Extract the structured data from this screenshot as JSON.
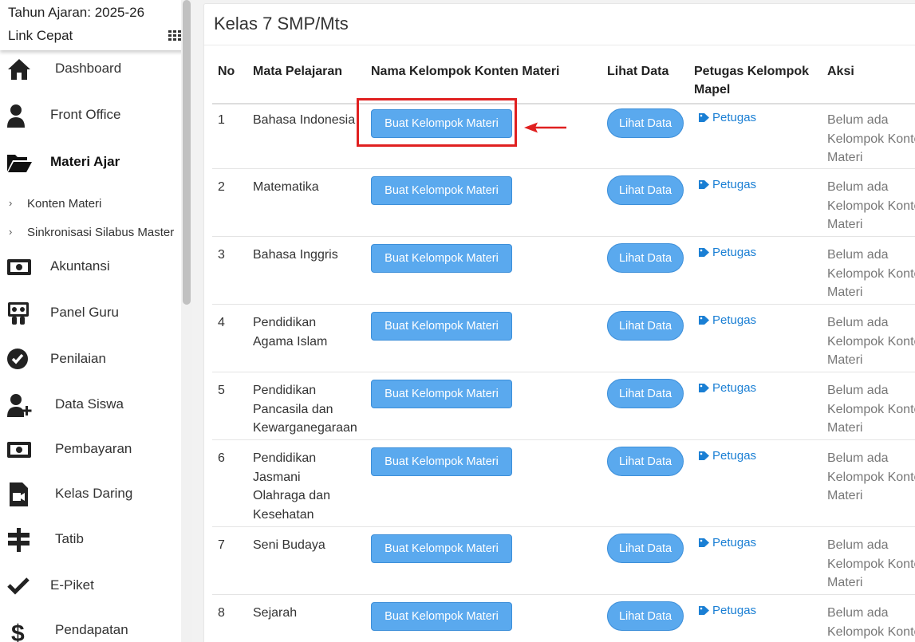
{
  "sidebar": {
    "academic_year": "Tahun Ajaran: 2025-26",
    "quick_link": "Link Cepat",
    "items": [
      {
        "label": "Dashboard",
        "icon": "home-icon"
      },
      {
        "label": "Front Office",
        "icon": "user-icon"
      },
      {
        "label": "Materi Ajar",
        "icon": "folder-open-icon",
        "active": true
      },
      {
        "label": "Akuntansi",
        "icon": "money-icon"
      },
      {
        "label": "Panel Guru",
        "icon": "presentation-icon"
      },
      {
        "label": "Penilaian",
        "icon": "check-circle-icon"
      },
      {
        "label": "Data Siswa",
        "icon": "user-plus-icon"
      },
      {
        "label": "Pembayaran",
        "icon": "money-icon"
      },
      {
        "label": "Kelas Daring",
        "icon": "video-file-icon"
      },
      {
        "label": "Tatib",
        "icon": "signpost-icon"
      },
      {
        "label": "E-Piket",
        "icon": "checkmark-icon"
      },
      {
        "label": "Pendapatan",
        "icon": "dollar-icon"
      }
    ],
    "submenu": [
      {
        "label": "Konten Materi"
      },
      {
        "label": "Sinkronisasi Silabus Master"
      }
    ]
  },
  "main": {
    "title": "Kelas 7 SMP/Mts",
    "columns": [
      "No",
      "Mata Pelajaran",
      "Nama Kelompok Konten Materi",
      "Lihat Data",
      "Petugas Kelompok Mapel",
      "Aksi"
    ],
    "buat_label": "Buat Kelompok Materi",
    "lihat_label": "Lihat Data",
    "petugas_label": "Petugas",
    "aksi_lines": [
      "Belum ada",
      "Kelompok Konten",
      "Materi"
    ],
    "rows": [
      {
        "no": "1",
        "mapel_lines": [
          "Bahasa Indonesia"
        ]
      },
      {
        "no": "2",
        "mapel_lines": [
          "Matematika"
        ]
      },
      {
        "no": "3",
        "mapel_lines": [
          "Bahasa Inggris"
        ]
      },
      {
        "no": "4",
        "mapel_lines": [
          "Pendidikan",
          "Agama Islam"
        ]
      },
      {
        "no": "5",
        "mapel_lines": [
          "Pendidikan",
          "Pancasila dan",
          "Kewarganegaraan"
        ]
      },
      {
        "no": "6",
        "mapel_lines": [
          "Pendidikan",
          "Jasmani",
          "Olahraga dan",
          "Kesehatan"
        ]
      },
      {
        "no": "7",
        "mapel_lines": [
          "Seni Budaya"
        ]
      },
      {
        "no": "8",
        "mapel_lines": [
          "Sejarah"
        ]
      }
    ]
  },
  "colors": {
    "button": "#5aa9ee",
    "link": "#1a7fd4",
    "highlight": "#e02020"
  }
}
